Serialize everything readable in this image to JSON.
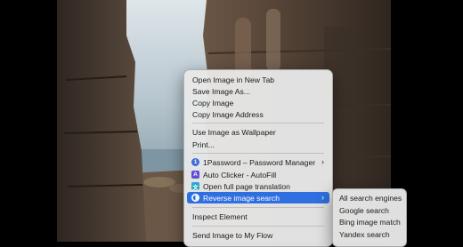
{
  "context_menu": {
    "items": [
      {
        "label": "Open Image in New Tab"
      },
      {
        "label": "Save Image As..."
      },
      {
        "label": "Copy Image"
      },
      {
        "label": "Copy Image Address"
      },
      {
        "label": "Use Image as Wallpaper"
      },
      {
        "label": "Print..."
      },
      {
        "label": "1Password – Password Manager",
        "icon": "1password-icon",
        "icon_color": "#3f6ad8"
      },
      {
        "label": "Auto Clicker - AutoFill",
        "icon": "auto-clicker-icon",
        "icon_color": "#5b4fd6"
      },
      {
        "label": "Open full page translation",
        "icon": "translate-icon",
        "icon_color": "#2aa8c9"
      },
      {
        "label": "Reverse image search",
        "icon": "reverse-search-icon",
        "icon_color": "#ffffff"
      },
      {
        "label": "Inspect Element"
      },
      {
        "label": "Send Image to My Flow"
      }
    ],
    "highlight_color": "#2f6fe0"
  },
  "submenu": {
    "items": [
      {
        "label": "All search engines"
      },
      {
        "label": "Google search"
      },
      {
        "label": "Bing image match"
      },
      {
        "label": "Yandex search"
      }
    ]
  }
}
